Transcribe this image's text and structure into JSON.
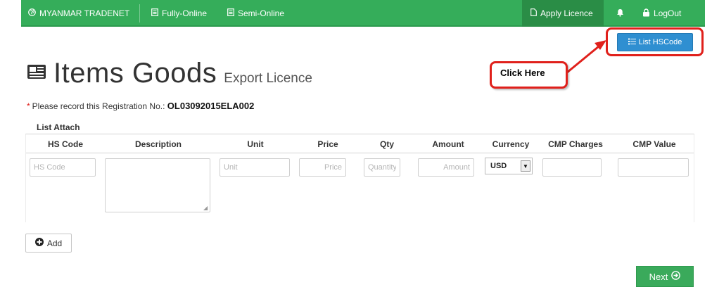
{
  "navbar": {
    "brand": "MYANMAR TRADENET",
    "fully_online": "Fully-Online",
    "semi_online": "Semi-Online",
    "apply_licence": "Apply Licence",
    "logout": "LogOut",
    "bg_color": "#35ad5a"
  },
  "toolbar": {
    "list_hscode_label": "List HSCode"
  },
  "callout": {
    "text": "Click Here",
    "color": "#e0201b"
  },
  "heading": {
    "title": "Items Goods",
    "subtitle": "Export Licence"
  },
  "registration": {
    "star": "*",
    "text": "Please record this Registration No.:",
    "number": "OL03092015ELA002"
  },
  "table": {
    "caption": "List Attach",
    "headers": [
      "HS Code",
      "Description",
      "Unit",
      "Price",
      "Qty",
      "Amount",
      "Currency",
      "CMP Charges",
      "CMP Value"
    ],
    "row": {
      "hs_code_placeholder": "HS Code",
      "unit_placeholder": "Unit",
      "price_placeholder": "Price",
      "qty_placeholder": "Quantity",
      "amount_placeholder": "Amount",
      "currency_value": "USD"
    }
  },
  "actions": {
    "add_label": "Add",
    "next_label": "Next"
  },
  "icons": [
    "globe-icon",
    "doc-icon",
    "bell-icon",
    "lock-icon",
    "list-icon",
    "plus-circle-icon",
    "arrow-circle-right-icon"
  ]
}
